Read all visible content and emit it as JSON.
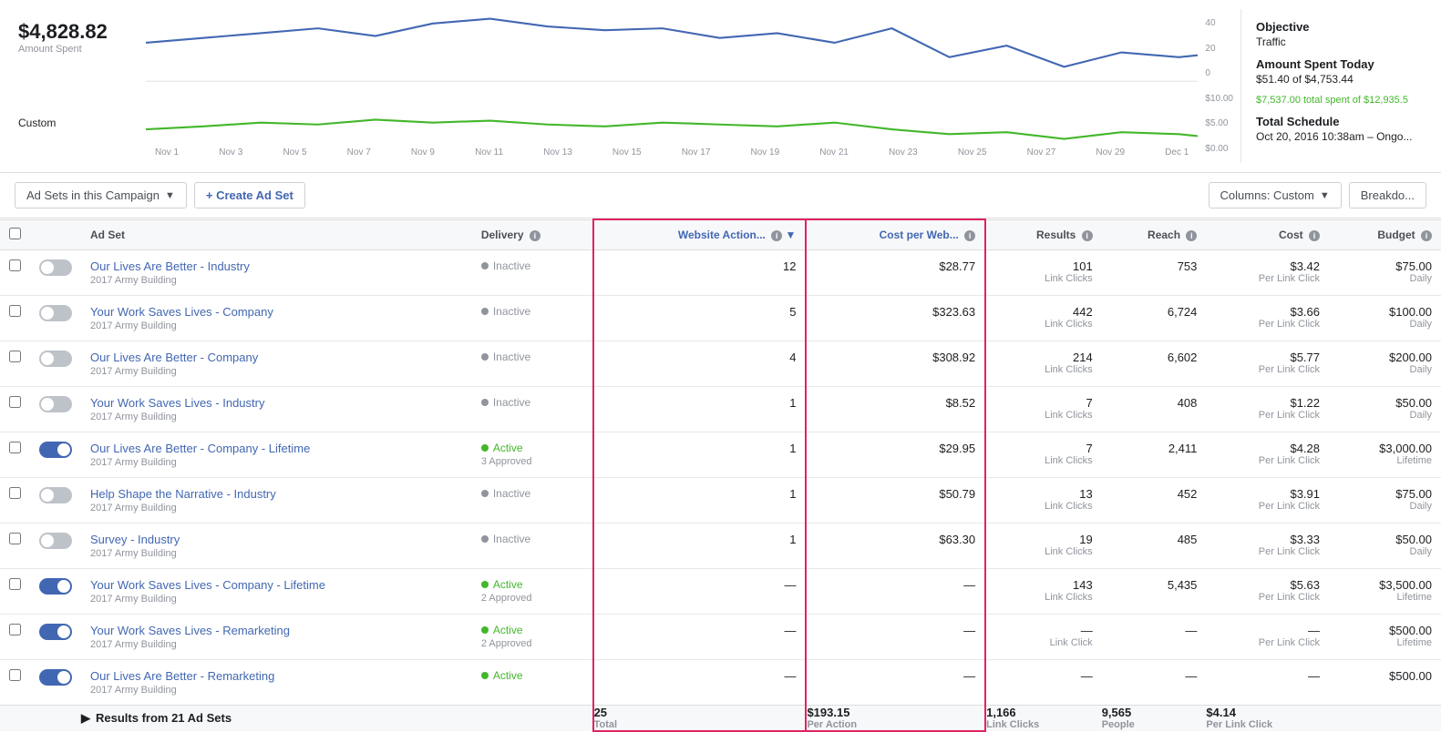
{
  "topSection": {
    "amountSpent": "$4,828.82",
    "amountLabel": "Amount Spent",
    "customLabel": "Custom",
    "objective": {
      "title": "Objective",
      "value": "Traffic"
    },
    "amountSpentToday": {
      "title": "Amount Spent Today",
      "value": "$51.40 of $4,753.44",
      "greenText": "$7,537.00 total spent of $12,935.5"
    },
    "totalSchedule": {
      "title": "Total Schedule",
      "value": "Oct 20, 2016 10:38am – Ongo..."
    },
    "xAxisLabels": [
      "Nov 1",
      "Nov 3",
      "Nov 5",
      "Nov 7",
      "Nov 9",
      "Nov 11",
      "Nov 13",
      "Nov 15",
      "Nov 17",
      "Nov 19",
      "Nov 21",
      "Nov 23",
      "Nov 25",
      "Nov 27",
      "Nov 29",
      "Dec 1"
    ],
    "yAxisRight": [
      "40",
      "20",
      "0"
    ],
    "yAxisBottom": [
      "$10.00",
      "$5.00",
      "$0.00"
    ]
  },
  "toolbar": {
    "adSetsLabel": "Ad Sets in this Campaign",
    "createLabel": "+ Create Ad Set",
    "columnsLabel": "Columns: Custom",
    "breakdownLabel": "Breakdo..."
  },
  "table": {
    "headers": [
      {
        "key": "checkbox",
        "label": ""
      },
      {
        "key": "toggle",
        "label": ""
      },
      {
        "key": "adSet",
        "label": "Ad Set"
      },
      {
        "key": "delivery",
        "label": "Delivery"
      },
      {
        "key": "websiteAction",
        "label": "Website Action...",
        "highlighted": true,
        "hasInfo": true,
        "hasSort": true
      },
      {
        "key": "costPerWeb",
        "label": "Cost per Web...",
        "highlighted": true,
        "hasInfo": true
      },
      {
        "key": "results",
        "label": "Results",
        "hasInfo": true
      },
      {
        "key": "reach",
        "label": "Reach",
        "hasInfo": true
      },
      {
        "key": "cost",
        "label": "Cost",
        "hasInfo": true
      },
      {
        "key": "budget",
        "label": "Budget",
        "hasInfo": true
      }
    ],
    "rows": [
      {
        "name": "Our Lives Are Better - Industry",
        "sub": "2017 Army Building",
        "active": false,
        "deliveryText": "Inactive",
        "deliverySub": "",
        "websiteAction": "12",
        "costPerWeb": "$28.77",
        "results": "101",
        "resultsSub": "Link Clicks",
        "reach": "753",
        "cost": "$3.42",
        "costSub": "Per Link Click",
        "budget": "$75.00",
        "budgetSub": "Daily"
      },
      {
        "name": "Your Work Saves Lives - Company",
        "sub": "2017 Army Building",
        "active": false,
        "deliveryText": "Inactive",
        "deliverySub": "",
        "websiteAction": "5",
        "costPerWeb": "$323.63",
        "results": "442",
        "resultsSub": "Link Clicks",
        "reach": "6,724",
        "cost": "$3.66",
        "costSub": "Per Link Click",
        "budget": "$100.00",
        "budgetSub": "Daily"
      },
      {
        "name": "Our Lives Are Better - Company",
        "sub": "2017 Army Building",
        "active": false,
        "deliveryText": "Inactive",
        "deliverySub": "",
        "websiteAction": "4",
        "costPerWeb": "$308.92",
        "results": "214",
        "resultsSub": "Link Clicks",
        "reach": "6,602",
        "cost": "$5.77",
        "costSub": "Per Link Click",
        "budget": "$200.00",
        "budgetSub": "Daily"
      },
      {
        "name": "Your Work Saves Lives - Industry",
        "sub": "2017 Army Building",
        "active": false,
        "deliveryText": "Inactive",
        "deliverySub": "",
        "websiteAction": "1",
        "costPerWeb": "$8.52",
        "results": "7",
        "resultsSub": "Link Clicks",
        "reach": "408",
        "cost": "$1.22",
        "costSub": "Per Link Click",
        "budget": "$50.00",
        "budgetSub": "Daily"
      },
      {
        "name": "Our Lives Are Better - Company - Lifetime",
        "sub": "2017 Army Building",
        "active": true,
        "deliveryText": "Active",
        "deliverySub": "3 Approved",
        "websiteAction": "1",
        "costPerWeb": "$29.95",
        "results": "7",
        "resultsSub": "Link Clicks",
        "reach": "2,411",
        "cost": "$4.28",
        "costSub": "Per Link Click",
        "budget": "$3,000.00",
        "budgetSub": "Lifetime"
      },
      {
        "name": "Help Shape the Narrative - Industry",
        "sub": "2017 Army Building",
        "active": false,
        "deliveryText": "Inactive",
        "deliverySub": "",
        "websiteAction": "1",
        "costPerWeb": "$50.79",
        "results": "13",
        "resultsSub": "Link Clicks",
        "reach": "452",
        "cost": "$3.91",
        "costSub": "Per Link Click",
        "budget": "$75.00",
        "budgetSub": "Daily"
      },
      {
        "name": "Survey - Industry",
        "sub": "2017 Army Building",
        "active": false,
        "deliveryText": "Inactive",
        "deliverySub": "",
        "websiteAction": "1",
        "costPerWeb": "$63.30",
        "results": "19",
        "resultsSub": "Link Clicks",
        "reach": "485",
        "cost": "$3.33",
        "costSub": "Per Link Click",
        "budget": "$50.00",
        "budgetSub": "Daily"
      },
      {
        "name": "Your Work Saves Lives - Company - Lifetime",
        "sub": "2017 Army Building",
        "active": true,
        "deliveryText": "Active",
        "deliverySub": "2 Approved",
        "websiteAction": "—",
        "costPerWeb": "—",
        "results": "143",
        "resultsSub": "Link Clicks",
        "reach": "5,435",
        "cost": "$5.63",
        "costSub": "Per Link Click",
        "budget": "$3,500.00",
        "budgetSub": "Lifetime"
      },
      {
        "name": "Your Work Saves Lives - Remarketing",
        "sub": "2017 Army Building",
        "active": true,
        "deliveryText": "Active",
        "deliverySub": "2 Approved",
        "websiteAction": "—",
        "costPerWeb": "—",
        "results": "—",
        "resultsSub": "Link Click",
        "reach": "—",
        "cost": "—",
        "costSub": "Per Link Click",
        "budget": "$500.00",
        "budgetSub": "Lifetime"
      },
      {
        "name": "Our Lives Are Better - Remarketing",
        "sub": "2017 Army Building",
        "active": true,
        "deliveryText": "Active",
        "deliverySub": "",
        "websiteAction": "—",
        "costPerWeb": "—",
        "results": "—",
        "resultsSub": "",
        "reach": "—",
        "cost": "—",
        "costSub": "",
        "budget": "$500.00",
        "budgetSub": ""
      }
    ],
    "footer": {
      "label": "Results from 21 Ad Sets",
      "websiteAction": "25",
      "websiteActionSub": "Total",
      "costPerWeb": "$193.15",
      "costPerWebSub": "Per Action",
      "results": "1,166",
      "resultsSub": "Link Clicks",
      "reach": "9,565",
      "reachSub": "People",
      "cost": "$4.14",
      "costSub": "Per Link Click",
      "budget": "",
      "budgetSub": ""
    }
  }
}
